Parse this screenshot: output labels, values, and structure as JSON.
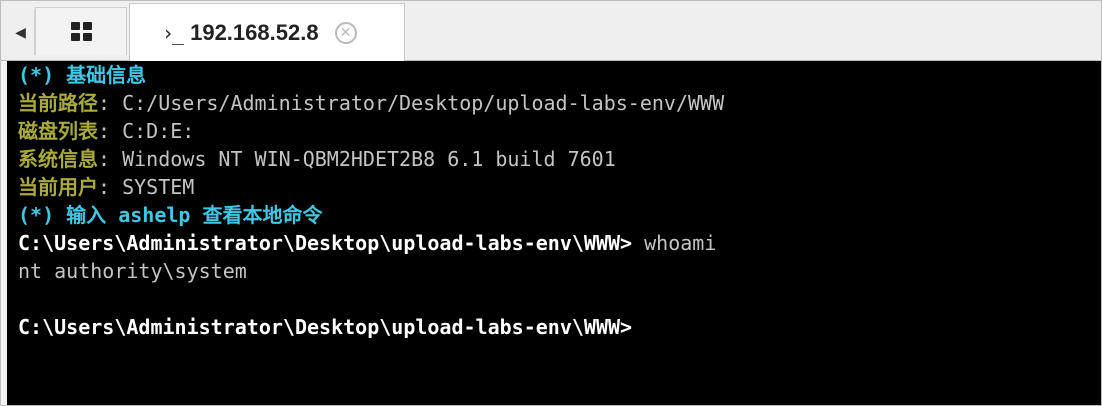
{
  "tabbar": {
    "scroll_left_label": "◀",
    "active_tab": {
      "prompt_glyph": "›_",
      "title": "192.168.52.8",
      "close_glyph": "✕"
    }
  },
  "terminal": {
    "lines": [
      {
        "parts": [
          {
            "text": "(*) 基础信息",
            "style": "cyan"
          }
        ]
      },
      {
        "parts": [
          {
            "text": "当前路径",
            "style": "olive"
          },
          {
            "text": ": C:/Users/Administrator/Desktop/upload-labs-env/WWW",
            "style": "gray"
          }
        ]
      },
      {
        "parts": [
          {
            "text": "磁盘列表",
            "style": "olive"
          },
          {
            "text": ": C:D:E:",
            "style": "gray"
          }
        ]
      },
      {
        "parts": [
          {
            "text": "系统信息",
            "style": "olive"
          },
          {
            "text": ": Windows NT WIN-QBM2HDET2B8 6.1 build 7601",
            "style": "gray"
          }
        ]
      },
      {
        "parts": [
          {
            "text": "当前用户",
            "style": "olive"
          },
          {
            "text": ": SYSTEM",
            "style": "gray"
          }
        ]
      },
      {
        "parts": [
          {
            "text": "(*) 输入 ashelp 查看本地命令",
            "style": "cyan"
          }
        ]
      },
      {
        "parts": [
          {
            "text": "C:\\Users\\Administrator\\Desktop\\upload-labs-env\\WWW> ",
            "style": "white-bold"
          },
          {
            "text": "whoami",
            "style": "gray"
          }
        ]
      },
      {
        "parts": [
          {
            "text": "nt authority\\system",
            "style": "gray"
          }
        ]
      },
      {
        "parts": [
          {
            "text": "",
            "style": "gray"
          }
        ]
      },
      {
        "parts": [
          {
            "text": "C:\\Users\\Administrator\\Desktop\\upload-labs-env\\WWW>",
            "style": "white-bold"
          }
        ]
      }
    ]
  }
}
